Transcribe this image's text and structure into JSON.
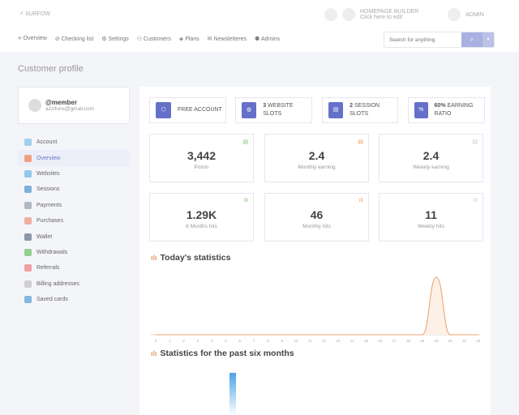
{
  "header": {
    "logo": "SURFOW",
    "builder_title": "HOMEPAGE BUILDER",
    "builder_sub": "Click here to edit",
    "user": "ADMIN"
  },
  "nav": [
    "Overview",
    "Checking list",
    "Settings",
    "Customers",
    "Plans",
    "Newsletteres",
    "Admins"
  ],
  "search": {
    "placeholder": "Search for anything"
  },
  "page_title": "Customer profile",
  "profile": {
    "username": "@member",
    "email": "azzifunx@gmail.com"
  },
  "sidebar": {
    "items": [
      {
        "label": "Account",
        "color": "#9fd0ee"
      },
      {
        "label": "Overview",
        "color": "#f0a080",
        "active": true
      },
      {
        "label": "Websites",
        "color": "#8fc8ea"
      },
      {
        "label": "Sessions",
        "color": "#7fb0d8"
      },
      {
        "label": "Payments",
        "color": "#b0b8c0"
      },
      {
        "label": "Purchases",
        "color": "#f0b0a0"
      },
      {
        "label": "Wallet",
        "color": "#8a98a8"
      },
      {
        "label": "Withdrawals",
        "color": "#90d090"
      },
      {
        "label": "Referrals",
        "color": "#f0a0a0"
      },
      {
        "label": "Billing addresses",
        "color": "#d0d0d0"
      },
      {
        "label": "Saved cards",
        "color": "#80b8e0"
      }
    ]
  },
  "badges": [
    {
      "icon": "shield-icon",
      "glyph": "⬡",
      "bold": "",
      "text": "FREE ACCOUNT"
    },
    {
      "icon": "globe-icon",
      "glyph": "◍",
      "bold": "3",
      "text": "WEBSITE SLOTS"
    },
    {
      "icon": "server-icon",
      "glyph": "▤",
      "bold": "2",
      "text": "SESSION SLOTS"
    },
    {
      "icon": "percent-icon",
      "glyph": "%",
      "bold": "60%",
      "text": "EARNING RATIO"
    }
  ],
  "stats": [
    {
      "value": "3,442",
      "label": "Points",
      "icon_color": "#7cc36a"
    },
    {
      "value": "2.4",
      "label": "Monthly earning",
      "icon_color": "#f0a060"
    },
    {
      "value": "2.4",
      "label": "Weekly earning",
      "icon_color": "#c8cce0"
    },
    {
      "value": "1.29K",
      "label": "6 Months hits",
      "icon_color": "#7cc36a"
    },
    {
      "value": "46",
      "label": "Monthly hits",
      "icon_color": "#f0a060"
    },
    {
      "value": "11",
      "label": "Weekly hits",
      "icon_color": "#c8cce0"
    }
  ],
  "today_title": "Today's statistics",
  "six_months_title": "Statistics for the past six months",
  "chart_data": [
    {
      "type": "area",
      "x": [
        "0",
        "1",
        "2",
        "3",
        "4",
        "5",
        "6",
        "7",
        "8",
        "9",
        "10",
        "11",
        "12",
        "13",
        "14",
        "15",
        "16",
        "17",
        "18",
        "19",
        "20",
        "21",
        "22",
        "23"
      ],
      "values": [
        0,
        0,
        0,
        0,
        0,
        0,
        0,
        0,
        0,
        0,
        0,
        0,
        0,
        0,
        0,
        0,
        0,
        0,
        0,
        0,
        1,
        0,
        0,
        0
      ],
      "color": "#e9a06c",
      "grid": false
    },
    {
      "type": "bar",
      "color": "#4aa3e8"
    }
  ]
}
